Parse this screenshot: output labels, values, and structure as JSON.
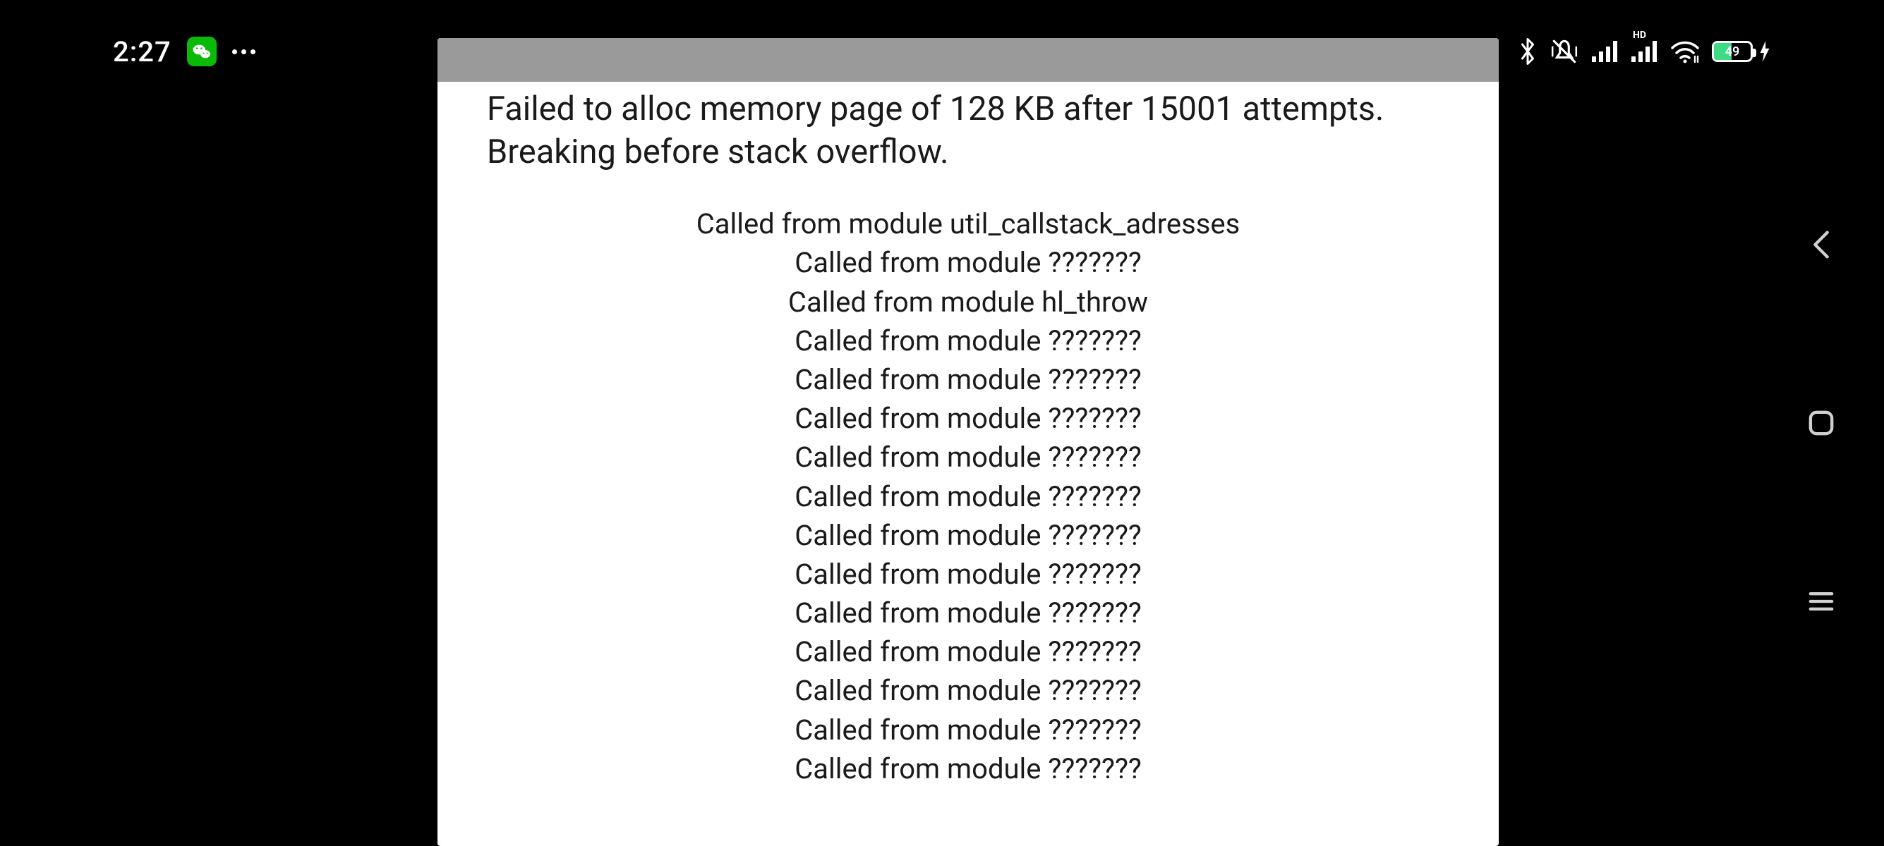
{
  "statusbar": {
    "time": "2:27",
    "battery_percent": "49",
    "battery_fill_pct": 49,
    "hd_label": "HD"
  },
  "error": {
    "message": "Failed to alloc memory page of 128 KB after 15001 attempts. Breaking before stack overflow.",
    "stack": [
      "Called from module util_callstack_adresses",
      "Called from module ???????",
      "Called from module hl_throw",
      "Called from module ???????",
      "Called from module ???????",
      "Called from module ???????",
      "Called from module ???????",
      "Called from module ???????",
      "Called from module ???????",
      "Called from module ???????",
      "Called from module ???????",
      "Called from module ???????",
      "Called from module ???????",
      "Called from module ???????",
      "Called from module ???????"
    ]
  }
}
